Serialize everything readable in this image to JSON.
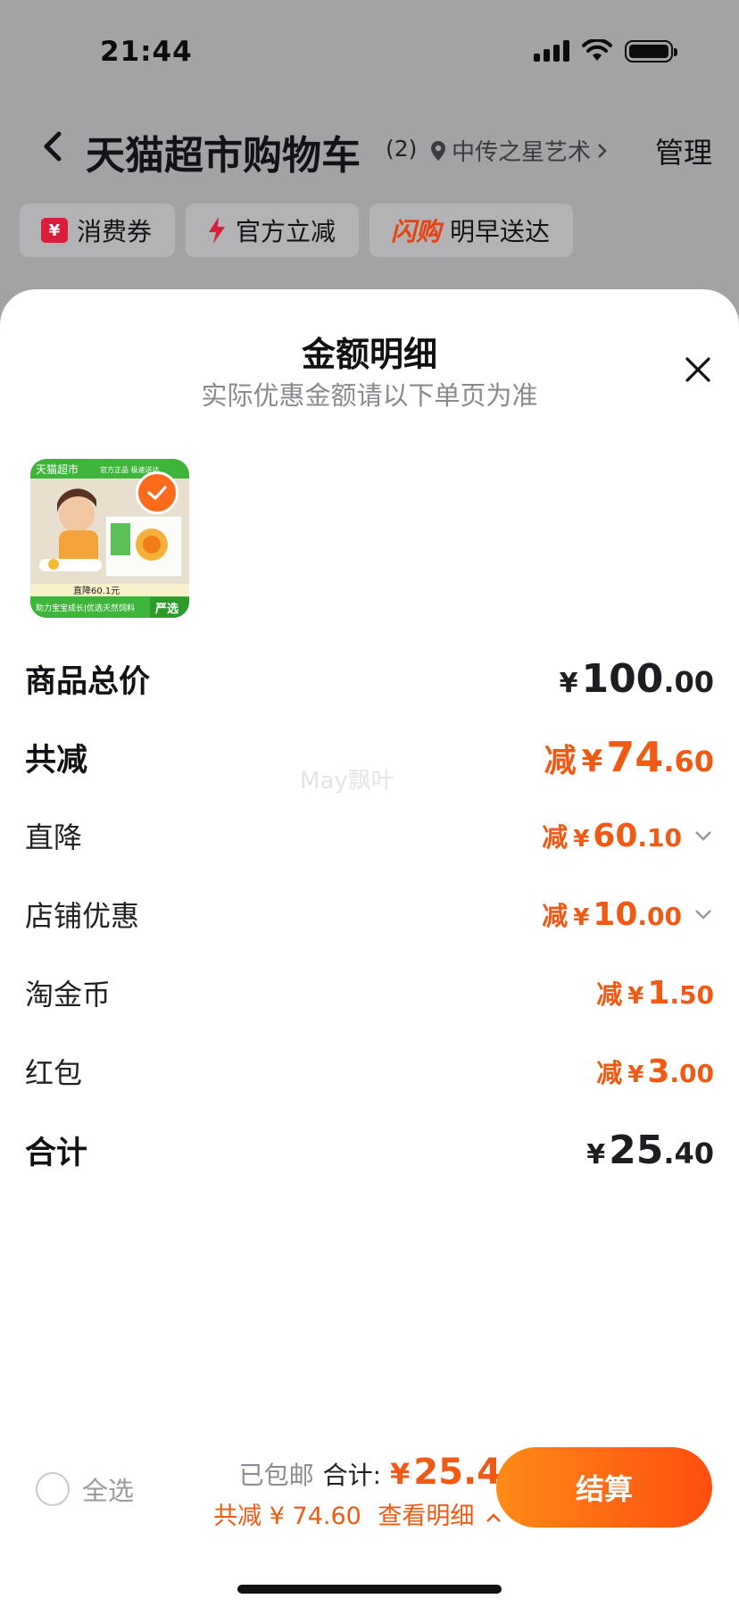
{
  "status_bar": {
    "time": "21:44"
  },
  "nav": {
    "title": "天猫超市购物车",
    "count": "(2)",
    "location": "中传之星艺术",
    "manage": "管理"
  },
  "chips": [
    {
      "label": "消费券",
      "icon": "coupon-icon",
      "badge": "¥"
    },
    {
      "label": "官方立减",
      "icon": "lightning-icon"
    },
    {
      "label": "明早送达",
      "logo": "闪购"
    }
  ],
  "sheet": {
    "title": "金额明细",
    "subtitle": "实际优惠金额请以下单页为准",
    "watermark": "May飘叶",
    "product": {
      "brand": "天猫超市",
      "tags": "官方正品 极速送达",
      "promo": "直降60.1元",
      "slogan": "助力宝宝成长|优选天然饲料",
      "badge": "严选"
    },
    "rows": [
      {
        "label": "商品总价",
        "prefix": "",
        "currency": "¥",
        "int": "100",
        "dec": ".00"
      },
      {
        "label": "共减",
        "prefix": "减",
        "currency": "¥",
        "int": "74",
        "dec": ".60"
      },
      {
        "label": "直降",
        "prefix": "减",
        "currency": "¥",
        "int": "60",
        "dec": ".10"
      },
      {
        "label": "店铺优惠",
        "prefix": "减",
        "currency": "¥",
        "int": "10",
        "dec": ".00"
      },
      {
        "label": "淘金币",
        "prefix": "减",
        "currency": "¥",
        "int": "1",
        "dec": ".50"
      },
      {
        "label": "红包",
        "prefix": "减",
        "currency": "¥",
        "int": "3",
        "dec": ".00"
      },
      {
        "label": "合计",
        "prefix": "",
        "currency": "¥",
        "int": "25",
        "dec": ".40"
      }
    ]
  },
  "bottom": {
    "select_all": "全选",
    "shipping": "已包邮",
    "total_label": "合计:",
    "total_currency": "¥",
    "total_value": "25.4",
    "discount_text": "共减 ¥ 74.60",
    "detail_link": "查看明细",
    "checkout": "结算"
  },
  "colors": {
    "accent": "#f05a14",
    "checkout_start": "#ff8a17",
    "checkout_end": "#ff4d0f"
  }
}
